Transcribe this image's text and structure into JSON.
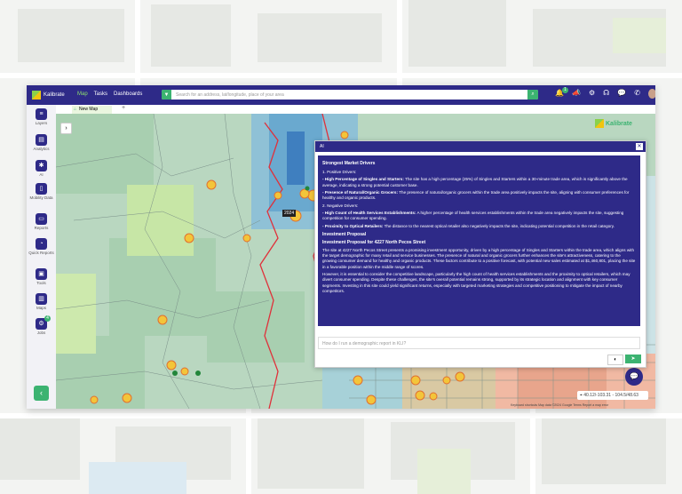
{
  "app": {
    "brand": "Kalibrate"
  },
  "nav": [
    "Map",
    "Tasks",
    "Dashboards"
  ],
  "search": {
    "placeholder": "Search for an address, lat/longitude, place of your area"
  },
  "toolbar": {
    "notification_count": "1"
  },
  "sidebar": {
    "items": [
      {
        "label": "Layers",
        "icon": "layers-icon"
      },
      {
        "label": "Analytics",
        "icon": "analytics-icon"
      },
      {
        "label": "AI",
        "icon": "ai-icon"
      },
      {
        "label": "Mobility Data",
        "icon": "mobility-icon"
      },
      {
        "label": "Reports",
        "icon": "reports-icon"
      },
      {
        "label": "Quick Reports",
        "icon": "quick-reports-icon"
      },
      {
        "label": "Tools",
        "icon": "tools-icon"
      },
      {
        "label": "Maps",
        "icon": "maps-icon"
      },
      {
        "label": "Jobs",
        "icon": "jobs-icon",
        "badge": "4"
      }
    ]
  },
  "tabs": {
    "active": "New Map"
  },
  "map": {
    "year_label": "2024",
    "coords": "40.12/-103.31 - 104.5/48.63",
    "attribution": "Keyboard shortcuts   Map data ©2024 Google   Terms   Report a map error",
    "brand": "Kalibrate"
  },
  "colors": {
    "primary": "#2e2a88",
    "accent": "#3cb371"
  },
  "ai_panel": {
    "title": "AI",
    "heading": "Strongest Market Drivers",
    "positive_title": "1. Positive Drivers:",
    "positive": [
      {
        "b": "- High Percentage of Singles and Starters:",
        "t": " The site has a high percentage (25%) of Singles and Starters within a 30-minute trade area, which is significantly above the average, indicating a strong potential customer base."
      },
      {
        "b": "- Presence of Natural/Organic Grocers:",
        "t": " The presence of natural/organic grocers within the trade area positively impacts the site, aligning with consumer preferences for healthy and organic products."
      }
    ],
    "negative_title": "2. Negative Drivers:",
    "negative": [
      {
        "b": "- High Count of Health Services Establishments:",
        "t": " A higher percentage of health services establishments within the trade area negatively impacts the site, suggesting competition for consumer spending."
      },
      {
        "b": "- Proximity to Optical Retailers:",
        "t": " The distance to the nearest optical retailer also negatively impacts the site, indicating potential competition in the retail category."
      }
    ],
    "investment_heading": "Investment Proposal",
    "investment_subheading": "Investment Proposal for 4227 North Pecos Street",
    "paragraph1": "The site at 4227 North Pecos Street presents a promising investment opportunity, driven by a high percentage of Singles and Starters within the trade area, which aligns with the target demographic for many retail and service businesses. The presence of natural and organic grocers further enhances the site's attractiveness, catering to the growing consumer demand for healthy and organic products. These factors contribute to a positive forecast, with potential new sales estimated at $1,460,801, placing the site in a favorable position within the middle range of scores.",
    "paragraph2": "However, it is essential to consider the competitive landscape, particularly the high count of health services establishments and the proximity to optical retailers, which may divert consumer spending. Despite these challenges, the site's overall potential remains strong, supported by its strategic location and alignment with key consumer segments. Investing in this site could yield significant returns, especially with targeted marketing strategies and competitive positioning to mitigate the impact of nearby competitors.",
    "input_placeholder": "How do I run a demographic report in KLI?"
  }
}
